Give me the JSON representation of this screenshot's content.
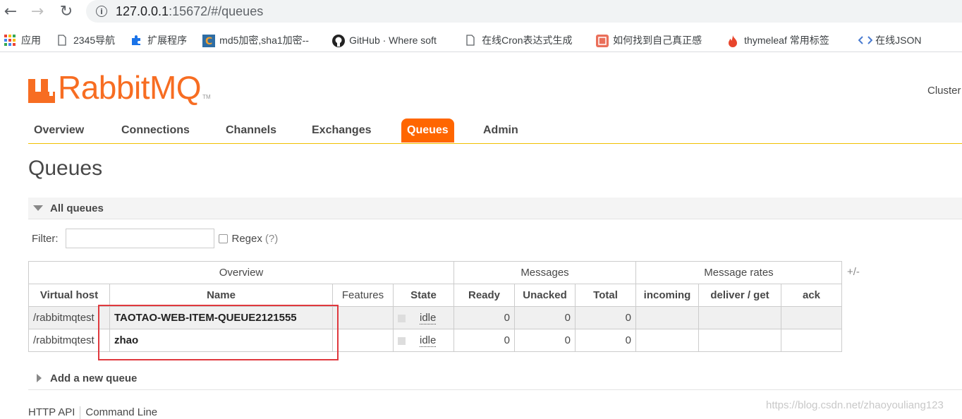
{
  "browser": {
    "url_host": "127.0.0.1",
    "url_rest": ":15672/#/queues",
    "bookmarks": [
      {
        "label": "应用",
        "icon": "apps-grid-icon"
      },
      {
        "label": "2345导航",
        "icon": "page-icon"
      },
      {
        "label": "扩展程序",
        "icon": "puzzle-icon"
      },
      {
        "label": "md5加密,sha1加密--",
        "icon": "c-logo-icon"
      },
      {
        "label": "GitHub · Where soft",
        "icon": "github-icon"
      },
      {
        "label": "在线Cron表达式生成",
        "icon": "page-icon"
      },
      {
        "label": "如何找到自己真正感",
        "icon": "jian-icon"
      },
      {
        "label": "thymeleaf 常用标签",
        "icon": "flame-icon"
      },
      {
        "label": "在线JSON",
        "icon": "code-icon"
      }
    ]
  },
  "app": {
    "logo_text": "RabbitMQ",
    "logo_tm": "TM",
    "cluster_label": "Cluster",
    "brand_color": "#f60"
  },
  "tabs": [
    "Overview",
    "Connections",
    "Channels",
    "Exchanges",
    "Queues",
    "Admin"
  ],
  "active_tab": "Queues",
  "page_title": "Queues",
  "section_title": "All queues",
  "filter": {
    "label": "Filter:",
    "value": "",
    "regex_label": "Regex",
    "regex_help": "(?)"
  },
  "table": {
    "groups": [
      "Overview",
      "Messages",
      "Message rates"
    ],
    "columns": [
      "Virtual host",
      "Name",
      "Features",
      "State",
      "Ready",
      "Unacked",
      "Total",
      "incoming",
      "deliver / get",
      "ack"
    ],
    "plus_minus": "+/-",
    "rows": [
      {
        "vhost": "/rabbitmqtest",
        "name": "TAOTAO-WEB-ITEM-QUEUE2121555",
        "features": "",
        "state": "idle",
        "ready": "0",
        "unacked": "0",
        "total": "0",
        "incoming": "",
        "deliver_get": "",
        "ack": ""
      },
      {
        "vhost": "/rabbitmqtest",
        "name": "zhao",
        "features": "",
        "state": "idle",
        "ready": "0",
        "unacked": "0",
        "total": "0",
        "incoming": "",
        "deliver_get": "",
        "ack": ""
      }
    ]
  },
  "add_queue_label": "Add a new queue",
  "footer": {
    "http_api": "HTTP API",
    "command_line": "Command Line"
  },
  "watermark": "https://blog.csdn.net/zhaoyouliang123"
}
